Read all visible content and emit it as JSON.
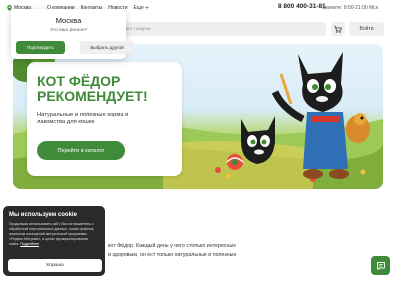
{
  "topbar": {
    "city": "Москва",
    "nav": [
      "О компании",
      "Контакты",
      "Новости",
      "Еще"
    ],
    "phone": "8 800 400-31-81",
    "hours": "Звоните: 9:00-21:00 Мск"
  },
  "search": {
    "placeholder": "...иск товаров"
  },
  "header": {
    "login_label": "Войти"
  },
  "city_popup": {
    "city": "Москва",
    "question": "Это ваш регион?",
    "confirm_label": "Подтвердить",
    "other_label": "Выбрать другой"
  },
  "hero": {
    "title": "КОТ ФЁДОР РЕКОМЕНДУЕТ!",
    "subtitle": "Натуральные и полезные корма и лакомства для кошек",
    "button_label": "Перейти в каталог"
  },
  "intro": {
    "line1": "кот Фёдор. Каждый день у него столько интересных",
    "line2": "и здоровым, он ест только натуральные и полезные"
  },
  "cookie": {
    "title": "Мы используем cookie",
    "text": "Продолжая использовать сайт, Вы соглашаетесь с обработкой персональных данных, cookie-файлов, анализом посещений метрической программы «Яндекс.Метрика», в целях функционирования сайта.",
    "link": "Подробнее",
    "button_label": "Хорошо"
  },
  "colors": {
    "brand_green": "#3f8b3a",
    "dark_panel": "#2a2a2a"
  },
  "icons": [
    "location-pin-icon",
    "chevron-down-icon",
    "cart-icon",
    "chat-icon"
  ]
}
